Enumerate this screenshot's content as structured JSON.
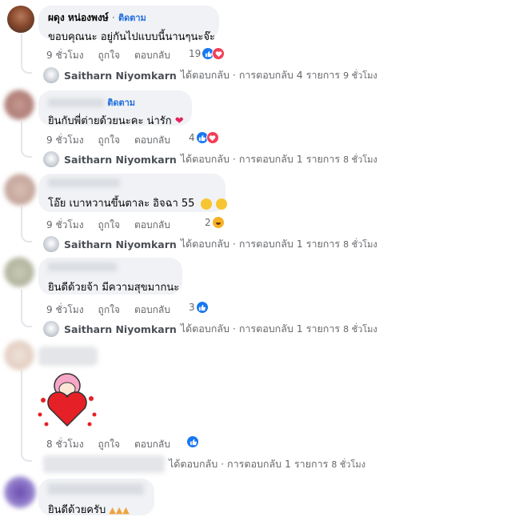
{
  "comments": [
    {
      "author": "ผดุง หน่องพงษ์",
      "follow": "ติดตาม",
      "text": "ขอบคุณนะ อยู่กันไปแบบนี้นานๆนะจ๊ะ",
      "time": "9 ชั่วโมง",
      "like": "ถูกใจ",
      "reply": "ตอบกลับ",
      "reactions": "19",
      "reply_author": "Saitharn Niyomkarn",
      "reply_text": "ได้ตอบกลับ · การตอบกลับ 4 รายการ",
      "reply_time": "9 ชั่วโมง"
    },
    {
      "author": "",
      "follow": "ติดตาม",
      "text": "ยินกับพี่ต่ายด้วยนะคะ น่ารัก",
      "time": "9 ชั่วโมง",
      "like": "ถูกใจ",
      "reply": "ตอบกลับ",
      "reactions": "4",
      "reply_author": "Saitharn Niyomkarn",
      "reply_text": "ได้ตอบกลับ · การตอบกลับ 1 รายการ",
      "reply_time": "8 ชั่วโมง"
    },
    {
      "author": "",
      "text": "โอ๊ย เบาหวานขึ้นตาละ อิจฉา 55",
      "time": "9 ชั่วโมง",
      "like": "ถูกใจ",
      "reply": "ตอบกลับ",
      "reactions": "2",
      "reply_author": "Saitharn Niyomkarn",
      "reply_text": "ได้ตอบกลับ · การตอบกลับ 1 รายการ",
      "reply_time": "8 ชั่วโมง"
    },
    {
      "author": "",
      "text": "ยินดีด้วยจ้า มีความสุขมากนะ",
      "time": "9 ชั่วโมง",
      "like": "ถูกใจ",
      "reply": "ตอบกลับ",
      "reactions": "3",
      "reply_author": "Saitharn Niyomkarn",
      "reply_text": "ได้ตอบกลับ · การตอบกลับ 1 รายการ",
      "reply_time": "8 ชั่วโมง"
    },
    {
      "author": "",
      "sticker": "heart-hug-sticker",
      "time": "8 ชั่วโมง",
      "like": "ถูกใจ",
      "reply": "ตอบกลับ",
      "reply_author": "",
      "reply_text": "ได้ตอบกลับ · การตอบกลับ 1 รายการ",
      "reply_time": "8 ชั่วโมง"
    },
    {
      "author": "",
      "text": "ยินดีด้วยครับ"
    }
  ],
  "colors": {
    "bubble": "#f0f2f5",
    "link": "#216fdb",
    "meta": "#65676b",
    "like": "#1877f2",
    "love": "#f33e58"
  }
}
